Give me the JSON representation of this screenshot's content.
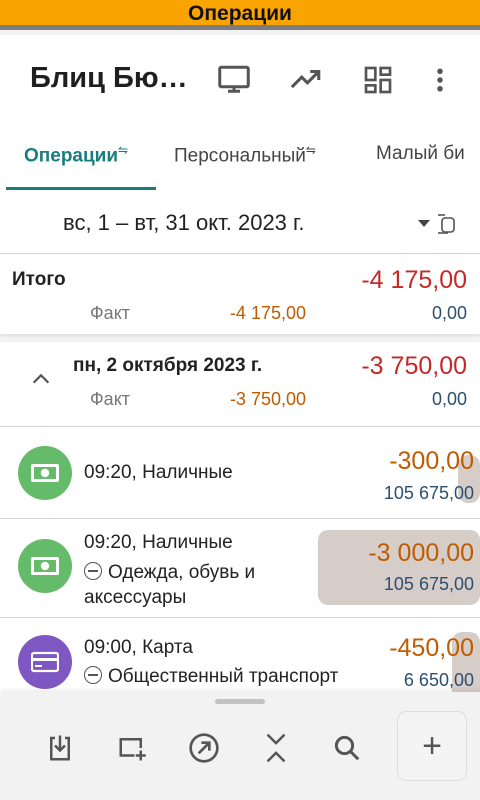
{
  "status_bar": {
    "title": "Операции"
  },
  "app_bar": {
    "title": "Блиц Бю…",
    "icons": [
      "monitor-icon",
      "trending-up-icon",
      "dashboard-grid-icon",
      "more-vertical-icon"
    ]
  },
  "tabs": [
    {
      "label": "Операции",
      "active": true
    },
    {
      "label": "Персональный",
      "active": false
    },
    {
      "label": "Малый би",
      "active": false
    }
  ],
  "period": {
    "label": "вс, 1 – вт, 31 окт. 2023 г."
  },
  "totals": {
    "title": "Итого",
    "amount": "-4 175,00",
    "fact_label": "Факт",
    "fact_amount": "-4 175,00",
    "fact_balance": "0,00"
  },
  "day": {
    "date": "пн, 2 октября 2023 г.",
    "amount": "-3 750,00",
    "fact_label": "Факт",
    "fact_amount": "-3 750,00",
    "fact_balance": "0,00"
  },
  "transactions": [
    {
      "time_account": "09:20, Наличные",
      "category": "",
      "amount": "-300,00",
      "balance": "105 675,00",
      "icon": "cash-icon"
    },
    {
      "time_account": "09:20, Наличные",
      "category": "Одежда, обувь и аксессуары",
      "amount": "-3 000,00",
      "balance": "105 675,00",
      "icon": "cash-icon"
    },
    {
      "time_account": "09:00, Карта",
      "category": "Общественный транспорт",
      "amount": "-450,00",
      "balance": "6 650,00",
      "icon": "credit-card-icon"
    }
  ],
  "bottom_bar": {
    "icons": [
      "import-icon",
      "add-window-icon",
      "arrow-up-right-circle-icon",
      "collapse-icon",
      "search-icon"
    ],
    "fab": "+"
  },
  "colors": {
    "accent": "#f9a400",
    "tab_active": "#1a7d7d",
    "negative": "#c62828",
    "expense": "#bf5b00",
    "balance": "#2d4f70"
  }
}
